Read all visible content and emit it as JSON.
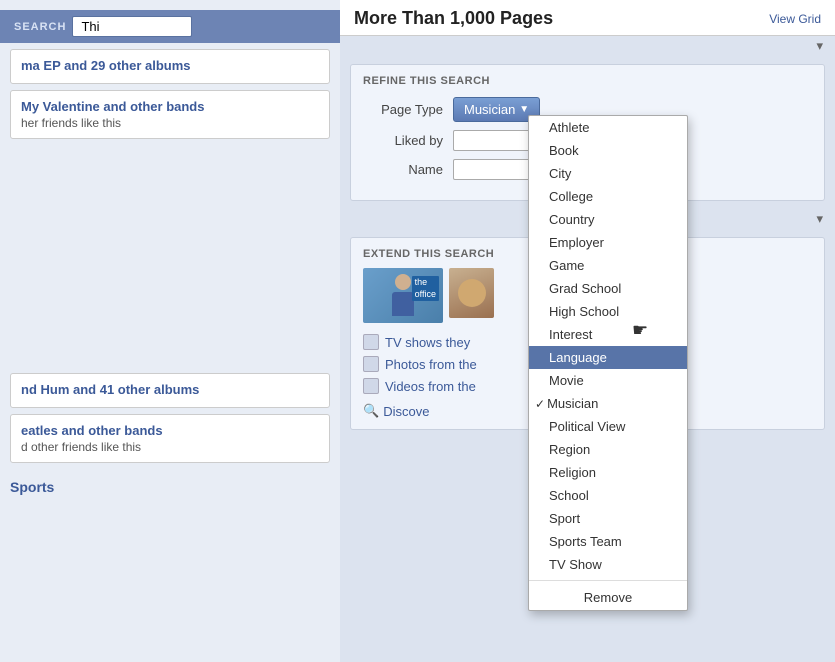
{
  "header": {
    "title": "More Than 1,000 Pages",
    "view_grid_label": "View Grid",
    "chevron": "▾"
  },
  "search_bar": {
    "label": "SEARCH",
    "placeholder": "Thi"
  },
  "refine": {
    "section_title": "REFINE THIS SEARCH",
    "page_type_label": "Page Type",
    "liked_by_label": "Liked by",
    "name_label": "Name",
    "dropdown_selected": "Musician",
    "dropdown_arrow": "▼"
  },
  "dropdown_items": [
    {
      "label": "Athlete",
      "checked": false,
      "highlighted": false
    },
    {
      "label": "Book",
      "checked": false,
      "highlighted": false
    },
    {
      "label": "City",
      "checked": false,
      "highlighted": false
    },
    {
      "label": "College",
      "checked": false,
      "highlighted": false
    },
    {
      "label": "Country",
      "checked": false,
      "highlighted": false
    },
    {
      "label": "Employer",
      "checked": false,
      "highlighted": false
    },
    {
      "label": "Game",
      "checked": false,
      "highlighted": false
    },
    {
      "label": "Grad School",
      "checked": false,
      "highlighted": false
    },
    {
      "label": "High School",
      "checked": false,
      "highlighted": false
    },
    {
      "label": "Interest",
      "checked": false,
      "highlighted": false
    },
    {
      "label": "Language",
      "checked": false,
      "highlighted": true
    },
    {
      "label": "Movie",
      "checked": false,
      "highlighted": false
    },
    {
      "label": "Musician",
      "checked": true,
      "highlighted": false
    },
    {
      "label": "Political View",
      "checked": false,
      "highlighted": false
    },
    {
      "label": "Region",
      "checked": false,
      "highlighted": false
    },
    {
      "label": "Religion",
      "checked": false,
      "highlighted": false
    },
    {
      "label": "School",
      "checked": false,
      "highlighted": false
    },
    {
      "label": "Sport",
      "checked": false,
      "highlighted": false
    },
    {
      "label": "Sports Team",
      "checked": false,
      "highlighted": false
    },
    {
      "label": "TV Show",
      "checked": false,
      "highlighted": false
    }
  ],
  "dropdown_remove": "Remove",
  "extend": {
    "section_title": "EXTEND THIS SEARCH",
    "items": [
      {
        "label": "TV shows they"
      },
      {
        "label": "Photos from the"
      },
      {
        "label": "Videos from the"
      }
    ],
    "discover_label": "Discove"
  },
  "left_panel": {
    "cards_top": [
      {
        "title": "ma EP and 29 other albums",
        "sub": ""
      },
      {
        "title": "My Valentine and other bands",
        "sub": "her friends like this"
      }
    ],
    "cards_bottom": [
      {
        "title": "nd Hum and 41 other albums",
        "sub": ""
      },
      {
        "title": "eatles and other bands",
        "sub": "d other friends like this"
      }
    ]
  },
  "sports_label": "Sports"
}
